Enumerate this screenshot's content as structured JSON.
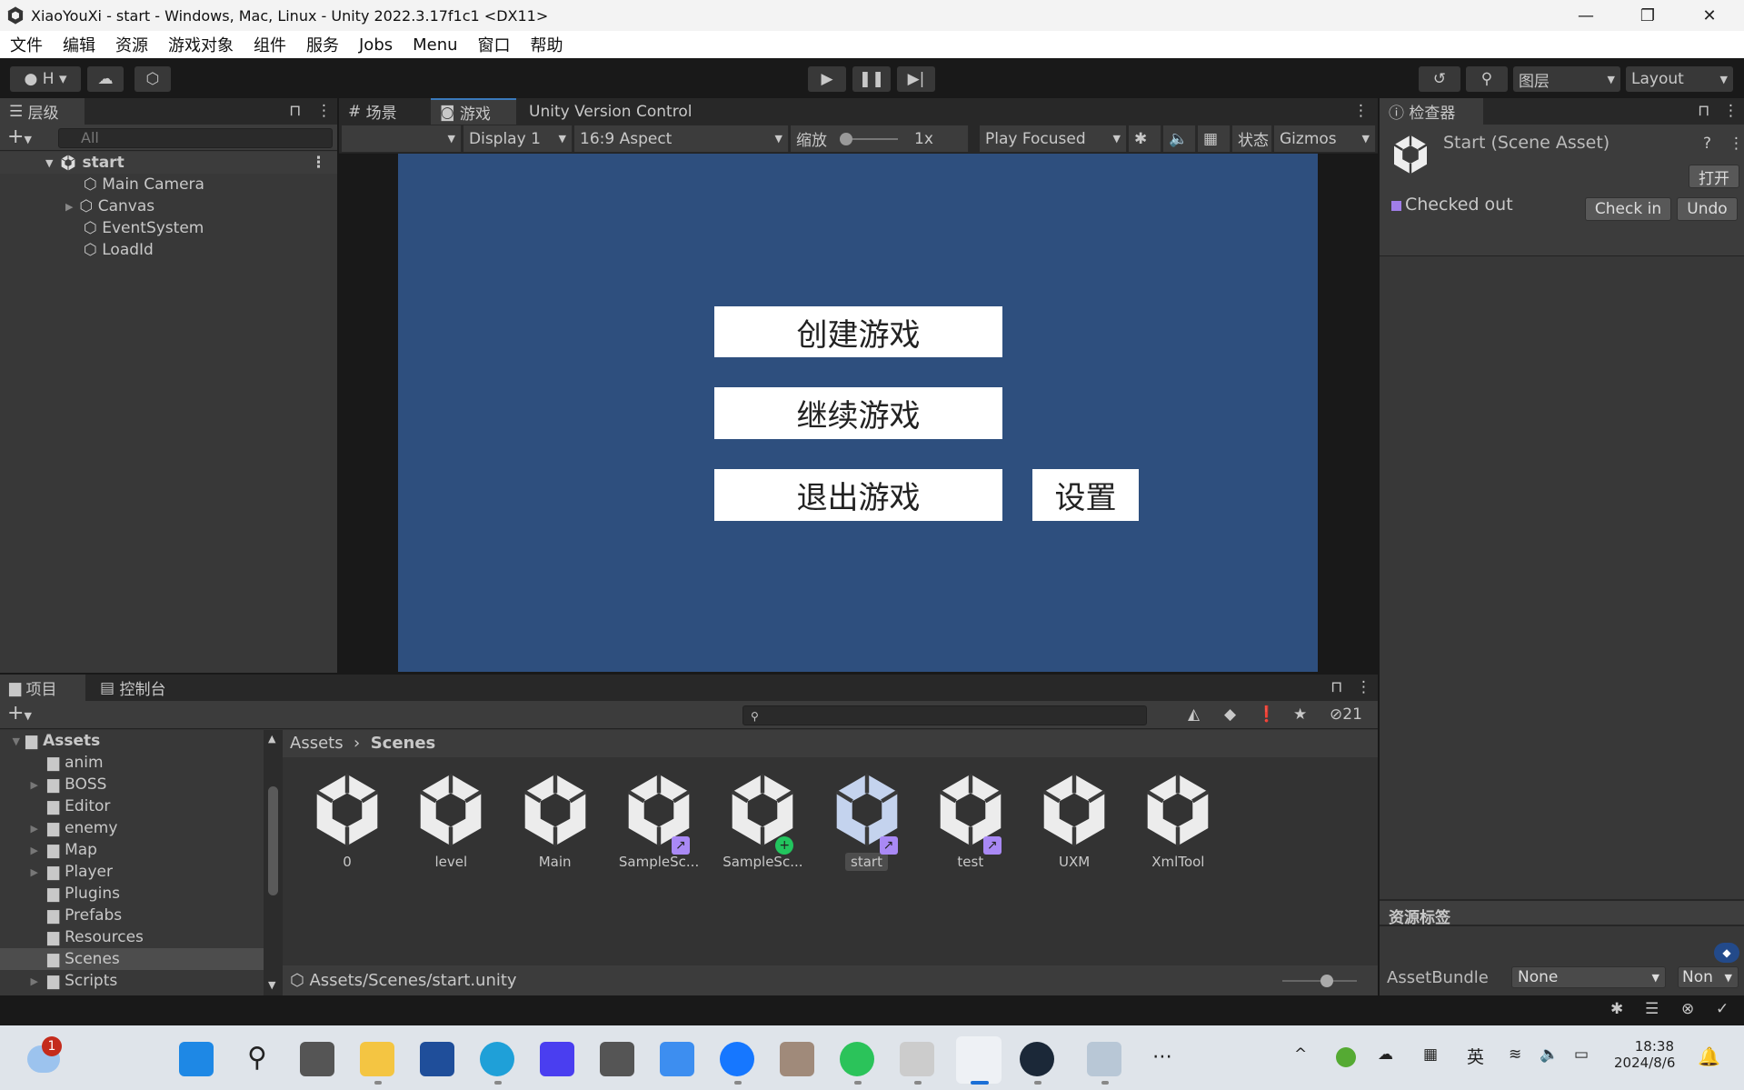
{
  "window": {
    "title": "XiaoYouXi - start - Windows, Mac, Linux - Unity 2022.3.17f1c1 <DX11>",
    "min": "—",
    "max": "❐",
    "close": "✕"
  },
  "menu": [
    "文件",
    "编辑",
    "资源",
    "游戏对象",
    "组件",
    "服务",
    "Jobs",
    "Menu",
    "窗口",
    "帮助"
  ],
  "toolbar": {
    "account": "H",
    "layers": "图层",
    "layout": "Layout"
  },
  "hierarchy": {
    "tab": "层级",
    "search_placeholder": "All",
    "scene": "start",
    "items": [
      "Main Camera",
      "Canvas",
      "EventSystem",
      "LoadId"
    ]
  },
  "game": {
    "tabs": [
      "场景",
      "游戏",
      "Unity Version Control"
    ],
    "display": "Display 1",
    "aspect": "16:9 Aspect",
    "scale_label": "缩放",
    "scale_value": "1x",
    "scale_fraction": 0,
    "play_mode": "Play Focused",
    "stats": "状态",
    "gizmos": "Gizmos",
    "bg_color": "#2e4f7e",
    "buttons": [
      "创建游戏",
      "继续游戏",
      "退出游戏",
      "设置"
    ]
  },
  "inspector": {
    "tab": "检查器",
    "title": "Start (Scene Asset)",
    "open": "打开",
    "status": "Checked out",
    "check_in": "Check in",
    "undo": "Undo",
    "labels_header": "资源标签",
    "assetbundle_label": "AssetBundle",
    "assetbundle_value": "None",
    "variant_value": "Non"
  },
  "project": {
    "tabs": [
      "项目",
      "控制台"
    ],
    "hidden_count": "21",
    "breadcrumb": [
      "Assets",
      "Scenes"
    ],
    "path": "Assets/Scenes/start.unity",
    "tree": [
      {
        "name": "Assets",
        "expanded": true
      },
      {
        "name": "anim"
      },
      {
        "name": "BOSS",
        "arrow": true
      },
      {
        "name": "Editor"
      },
      {
        "name": "enemy",
        "arrow": true
      },
      {
        "name": "Map",
        "arrow": true
      },
      {
        "name": "Player",
        "arrow": true
      },
      {
        "name": "Plugins"
      },
      {
        "name": "Prefabs"
      },
      {
        "name": "Resources"
      },
      {
        "name": "Scenes",
        "selected": true
      },
      {
        "name": "Scripts",
        "arrow": true
      }
    ],
    "assets": [
      {
        "name": "0"
      },
      {
        "name": "level"
      },
      {
        "name": "Main"
      },
      {
        "name": "SampleSc...",
        "badge": "checked-out"
      },
      {
        "name": "SampleSc...",
        "badge": "added"
      },
      {
        "name": "start",
        "badge": "checked-out",
        "selected": true
      },
      {
        "name": "test",
        "badge": "checked-out"
      },
      {
        "name": "UXM"
      },
      {
        "name": "XmlTool"
      }
    ]
  },
  "taskbar": {
    "notification_count": "1",
    "time": "18:38",
    "date": "2024/8/6",
    "ime": "英"
  }
}
